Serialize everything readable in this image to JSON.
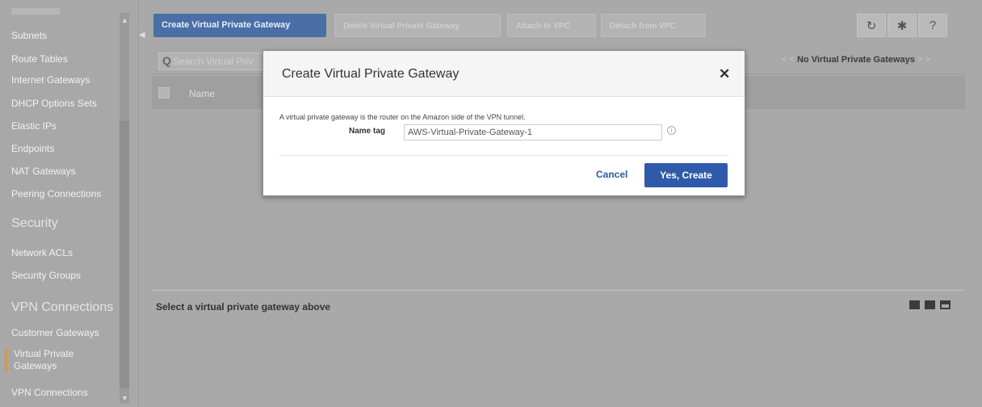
{
  "sidebar": {
    "items": [
      {
        "label": "Subnets"
      },
      {
        "label": "Route Tables"
      },
      {
        "label": "Internet Gateways"
      },
      {
        "label": "DHCP Options Sets"
      },
      {
        "label": "Elastic IPs"
      },
      {
        "label": "Endpoints"
      },
      {
        "label": "NAT Gateways"
      },
      {
        "label": "Peering Connections"
      }
    ],
    "security_header": "Security",
    "security_items": [
      {
        "label": "Network ACLs"
      },
      {
        "label": "Security Groups"
      }
    ],
    "vpn_header": "VPN Connections",
    "vpn_items": [
      {
        "label": "Customer Gateways"
      },
      {
        "label_line1": "Virtual Private",
        "label_line2": "Gateways"
      },
      {
        "label": "VPN Connections"
      }
    ],
    "active_accent": "#d89a3c"
  },
  "toolbar": {
    "create_label": "Create Virtual Private Gateway",
    "delete_label": "Delete Virtual Private Gateway",
    "attach_label": "Attach to VPC",
    "detach_label": "Detach from VPC",
    "icons": [
      "refresh-icon",
      "gear-icon",
      "help-icon"
    ]
  },
  "list": {
    "search_placeholder": "Search Virtual Priv",
    "pager_text": "No Virtual Private Gateways",
    "column_name": "Name"
  },
  "detail": {
    "empty_text": "Select a virtual private gateway above"
  },
  "modal": {
    "title": "Create Virtual Private Gateway",
    "description": "A virtual private gateway is the router on the Amazon side of the VPN tunnel.",
    "name_tag_label": "Name tag",
    "name_tag_value": "AWS-Virtual-Private-Gateway-1",
    "cancel_label": "Cancel",
    "create_label": "Yes, Create"
  },
  "colors": {
    "primary": "#2f5aa9",
    "overlay_bg": "#a9a9a9"
  }
}
